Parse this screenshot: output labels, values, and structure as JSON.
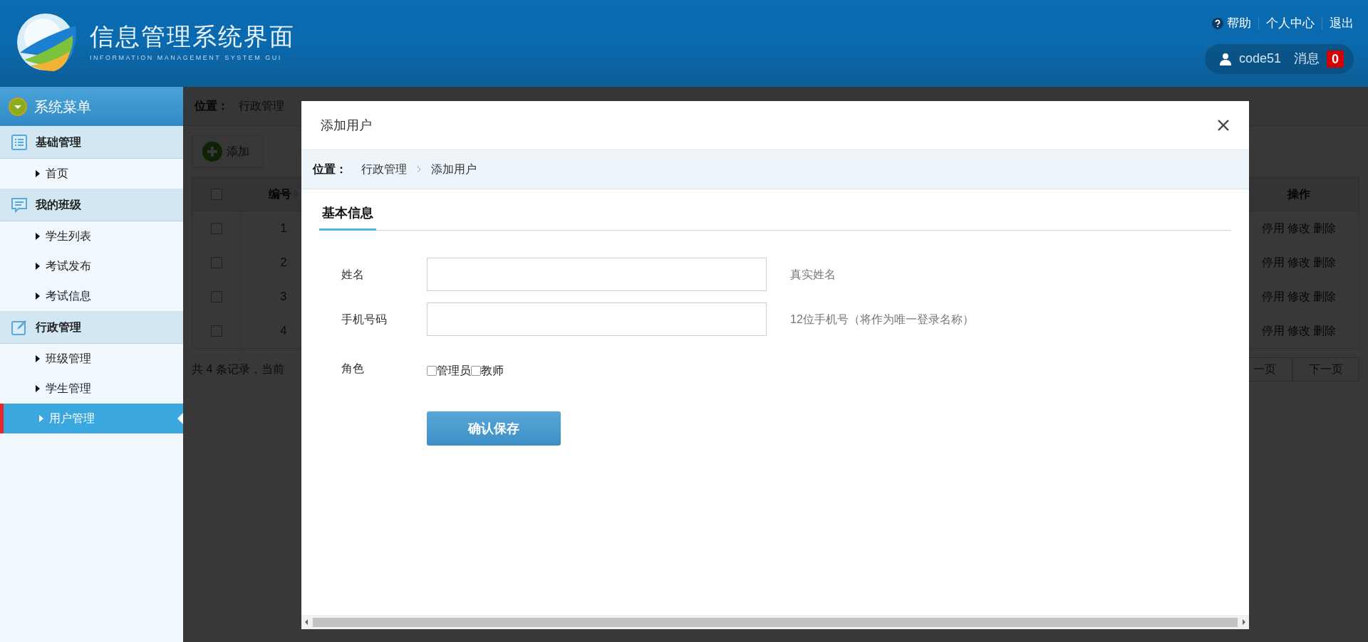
{
  "header": {
    "title": "信息管理系统界面",
    "subtitle": "INFORMATION MANAGEMENT SYSTEM GUI",
    "links": [
      "帮助",
      "个人中心",
      "退出"
    ],
    "user": {
      "name": "code51",
      "messages_label": "消息",
      "message_count": "0"
    }
  },
  "sidebar": {
    "title": "系统菜单",
    "groups": [
      {
        "label": "基础管理",
        "items": [
          {
            "label": "首页",
            "selected": false
          }
        ]
      },
      {
        "label": "我的班级",
        "items": [
          {
            "label": "学生列表",
            "selected": false
          },
          {
            "label": "考试发布",
            "selected": false
          },
          {
            "label": "考试信息",
            "selected": false
          }
        ]
      },
      {
        "label": "行政管理",
        "items": [
          {
            "label": "班级管理",
            "selected": false
          },
          {
            "label": "学生管理",
            "selected": false
          },
          {
            "label": "用户管理",
            "selected": true
          }
        ]
      }
    ]
  },
  "page": {
    "breadcrumb": {
      "label": "位置：",
      "path": [
        "行政管理"
      ]
    },
    "add_button": "添加",
    "table": {
      "columns": [
        "编号",
        "操作"
      ],
      "header_checked": false,
      "rows": [
        {
          "checked": false,
          "number": "1",
          "actions": [
            "停用",
            "修改",
            "删除"
          ]
        },
        {
          "checked": false,
          "number": "2",
          "actions": [
            "停用",
            "修改",
            "删除"
          ]
        },
        {
          "checked": false,
          "number": "3",
          "actions": [
            "停用",
            "修改",
            "删除"
          ]
        },
        {
          "checked": false,
          "number": "4",
          "actions": [
            "停用",
            "修改",
            "删除"
          ]
        }
      ]
    },
    "summary": "共 4 条记录，当前",
    "pagination": [
      "一页",
      "下一页"
    ]
  },
  "dialog": {
    "title": "添加用户",
    "breadcrumb": {
      "label": "位置：",
      "path": [
        "行政管理",
        "添加用户"
      ]
    },
    "tabs": [
      {
        "label": "基本信息",
        "selected": true
      }
    ],
    "fields": [
      {
        "kind": "text",
        "label": "姓名",
        "hint": "真实姓名"
      },
      {
        "kind": "text",
        "label": "手机号码",
        "hint": "12位手机号（将作为唯一登录名称）"
      },
      {
        "kind": "checkboxes",
        "label": "角色",
        "options": [
          {
            "label": "管理员",
            "checked": false
          },
          {
            "label": "教师",
            "checked": false
          }
        ]
      }
    ],
    "submit": "确认保存"
  }
}
